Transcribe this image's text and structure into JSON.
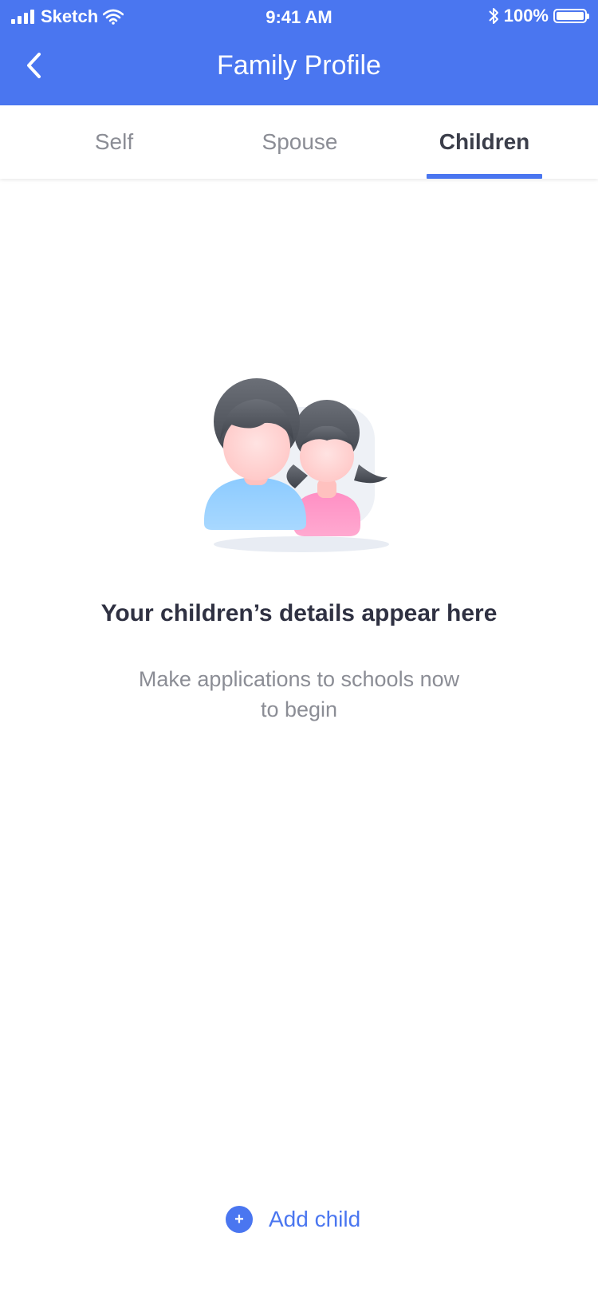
{
  "status_bar": {
    "carrier": "Sketch",
    "time": "9:41 AM",
    "battery": "100%"
  },
  "header": {
    "title": "Family Profile",
    "back_icon": "chevron-left-icon"
  },
  "tabs": [
    {
      "label": "Self",
      "active": false
    },
    {
      "label": "Spouse",
      "active": false
    },
    {
      "label": "Children",
      "active": true
    }
  ],
  "empty_state": {
    "illustration": "children-avatars",
    "title": "Your children’s details appear here",
    "subtitle_line1": "Make applications to schools now",
    "subtitle_line2": "to begin"
  },
  "actions": {
    "add_child_label": "Add child",
    "add_icon_glyph": "+"
  },
  "colors": {
    "primary": "#4a76f0",
    "text_dark": "#2f3142",
    "text_muted": "#8b8d95"
  }
}
